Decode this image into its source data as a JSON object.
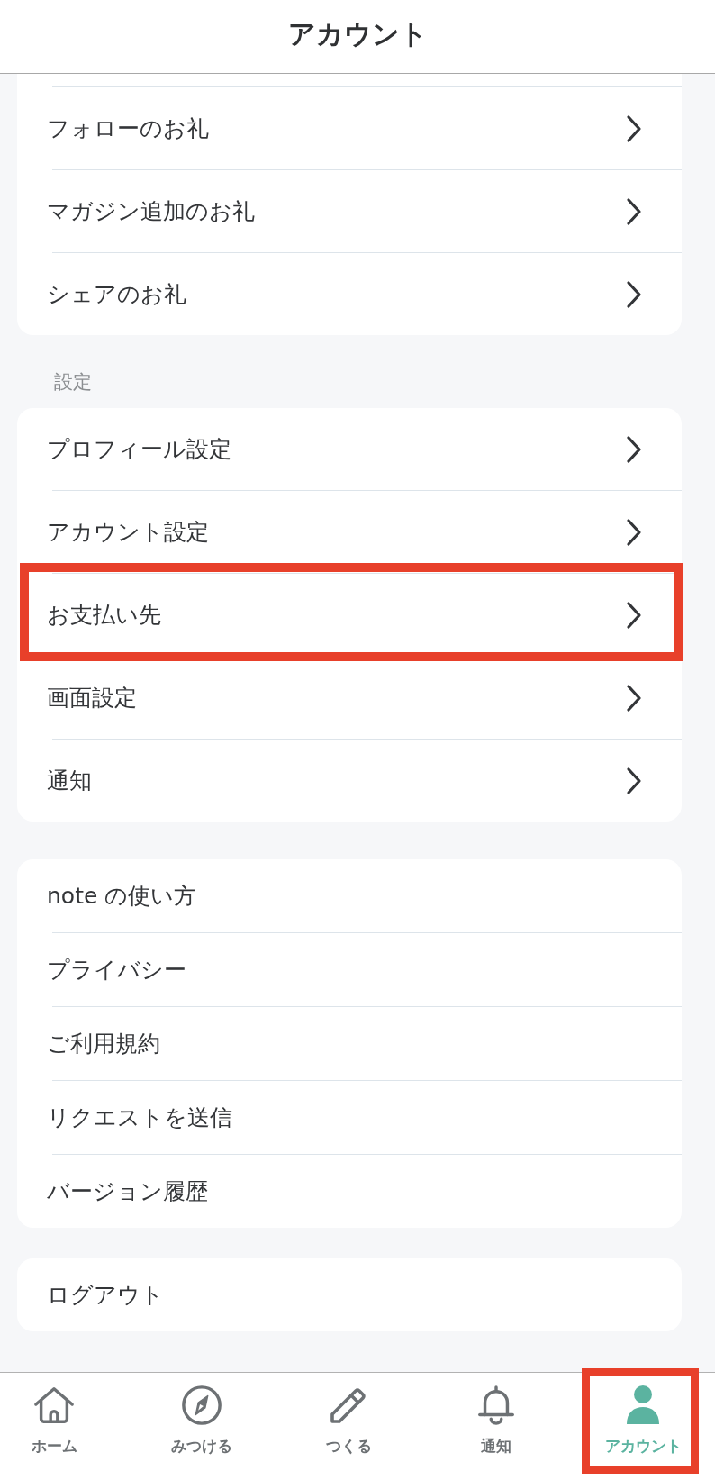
{
  "header": {
    "title": "アカウント"
  },
  "groups": [
    {
      "items": [
        {
          "label": "フォローのお礼",
          "chevron": true,
          "highlighted": false
        },
        {
          "label": "マガジン追加のお礼",
          "chevron": true,
          "highlighted": false
        },
        {
          "label": "シェアのお礼",
          "chevron": true,
          "highlighted": false
        }
      ]
    },
    {
      "heading": "設定",
      "items": [
        {
          "label": "プロフィール設定",
          "chevron": true,
          "highlighted": false
        },
        {
          "label": "アカウント設定",
          "chevron": true,
          "highlighted": false
        },
        {
          "label": "お支払い先",
          "chevron": true,
          "highlighted": true
        },
        {
          "label": "画面設定",
          "chevron": true,
          "highlighted": false
        },
        {
          "label": "通知",
          "chevron": true,
          "highlighted": false
        }
      ]
    },
    {
      "items": [
        {
          "label": "note の使い方",
          "chevron": false,
          "highlighted": false
        },
        {
          "label": "プライバシー",
          "chevron": false,
          "highlighted": false
        },
        {
          "label": "ご利用規約",
          "chevron": false,
          "highlighted": false
        },
        {
          "label": "リクエストを送信",
          "chevron": false,
          "highlighted": false
        },
        {
          "label": "バージョン履歴",
          "chevron": false,
          "highlighted": false
        }
      ]
    },
    {
      "items": [
        {
          "label": "ログアウト",
          "chevron": false,
          "highlighted": false
        }
      ]
    }
  ],
  "tab_bar": [
    {
      "label": "ホーム",
      "selected": false,
      "highlighted": false
    },
    {
      "label": "みつける",
      "selected": false,
      "highlighted": false
    },
    {
      "label": "つくる",
      "selected": false,
      "highlighted": false
    },
    {
      "label": "通知",
      "selected": false,
      "highlighted": false
    },
    {
      "label": "アカウント",
      "selected": true,
      "highlighted": true
    }
  ]
}
